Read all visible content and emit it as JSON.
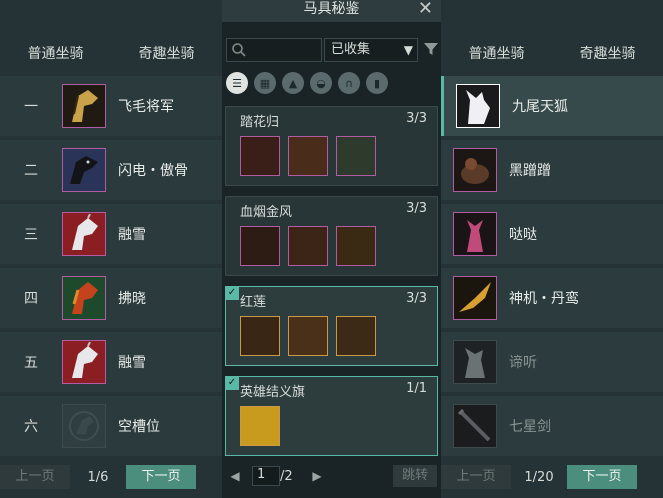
{
  "left": {
    "tabs": [
      "普通坐骑",
      "奇趣坐骑"
    ],
    "rows": [
      {
        "num": "一",
        "name": "飞毛将军",
        "icon": "golden-horse"
      },
      {
        "num": "二",
        "name": "闪电・傲骨",
        "icon": "black-horse"
      },
      {
        "num": "三",
        "name": "融雪",
        "icon": "white-horse"
      },
      {
        "num": "四",
        "name": "拂晓",
        "icon": "red-horse"
      },
      {
        "num": "五",
        "name": "融雪",
        "icon": "white-horse"
      },
      {
        "num": "六",
        "name": "空槽位",
        "icon": "empty-slot"
      }
    ],
    "pager": {
      "prev": "上一页",
      "count": "1/6",
      "next": "下一页"
    }
  },
  "middle": {
    "title": "马具秘鉴",
    "search_placeholder": "",
    "filter_value": "已收集",
    "sets": [
      {
        "name": "踏花归",
        "progress": "3/3",
        "items": 3,
        "complete": false
      },
      {
        "name": "血烟金风",
        "progress": "3/3",
        "items": 3,
        "complete": false
      },
      {
        "name": "红莲",
        "progress": "3/3",
        "items": 3,
        "complete": true
      },
      {
        "name": "英雄结义旗",
        "progress": "1/1",
        "items": 1,
        "complete": true
      }
    ],
    "pager": {
      "current": "1",
      "total": "/2",
      "jump": "跳转"
    }
  },
  "right": {
    "tabs": [
      "普通坐骑",
      "奇趣坐骑"
    ],
    "rows": [
      {
        "name": "九尾天狐",
        "icon": "white-fox",
        "selected": true,
        "dim": false
      },
      {
        "name": "黑蹭蹭",
        "icon": "brown-creature",
        "selected": false,
        "dim": false
      },
      {
        "name": "哒哒",
        "icon": "pink-deer",
        "selected": false,
        "dim": false
      },
      {
        "name": "神机・丹鸾",
        "icon": "golden-bird",
        "selected": false,
        "dim": false
      },
      {
        "name": "谛听",
        "icon": "grey-beast",
        "selected": false,
        "dim": true
      },
      {
        "name": "七星剑",
        "icon": "sword",
        "selected": false,
        "dim": true
      }
    ],
    "pager": {
      "prev": "上一页",
      "count": "1/20",
      "next": "下一页"
    }
  }
}
